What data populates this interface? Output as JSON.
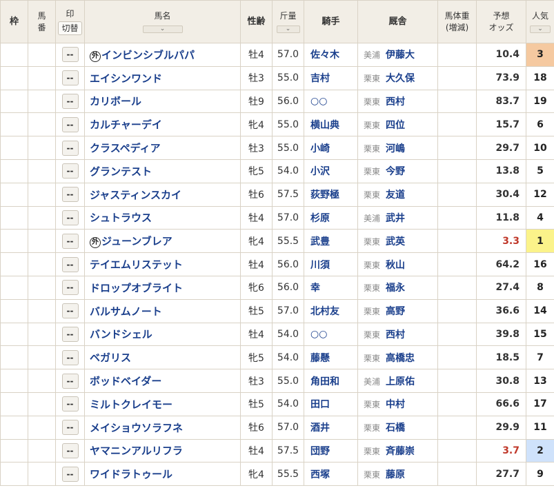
{
  "header": {
    "waku": "枠",
    "umaban_1": "馬",
    "umaban_2": "番",
    "mark": "印",
    "mark_toggle": "切替",
    "horse_name": "馬名",
    "sex_age": "性齢",
    "weight": "斤量",
    "jockey": "騎手",
    "stable": "厩舎",
    "body_weight_1": "馬体重",
    "body_weight_2": "(増減)",
    "odds_1": "予想",
    "odds_2": "オッズ",
    "popularity": "人気"
  },
  "mark_placeholder": "--",
  "foreign_badge": "外",
  "colors": {
    "header_bg": "#f2eee6",
    "link_blue": "#1a3f8c",
    "favorite_odds": "#c0392b",
    "pop1_bg": "#fbf38a",
    "pop2_bg": "#cfe2fb",
    "pop3_bg": "#f5c9a0"
  },
  "rows": [
    {
      "name": "インビンシブルパパ",
      "foreign": true,
      "sex_age": "牡4",
      "weight": "57.0",
      "jockey": "佐々木",
      "region": "美浦",
      "trainer": "伊藤大",
      "odds": "10.4",
      "popularity": "3"
    },
    {
      "name": "エイシンワンド",
      "foreign": false,
      "sex_age": "牡3",
      "weight": "55.0",
      "jockey": "吉村",
      "region": "栗東",
      "trainer": "大久保",
      "odds": "73.9",
      "popularity": "18"
    },
    {
      "name": "カリボール",
      "foreign": false,
      "sex_age": "牡9",
      "weight": "56.0",
      "jockey": "○○",
      "region": "栗東",
      "trainer": "西村",
      "odds": "83.7",
      "popularity": "19"
    },
    {
      "name": "カルチャーデイ",
      "foreign": false,
      "sex_age": "牝4",
      "weight": "55.0",
      "jockey": "横山典",
      "region": "栗東",
      "trainer": "四位",
      "odds": "15.7",
      "popularity": "6"
    },
    {
      "name": "クラスペディア",
      "foreign": false,
      "sex_age": "牡3",
      "weight": "55.0",
      "jockey": "小崎",
      "region": "栗東",
      "trainer": "河嶋",
      "odds": "29.7",
      "popularity": "10"
    },
    {
      "name": "グランテスト",
      "foreign": false,
      "sex_age": "牝5",
      "weight": "54.0",
      "jockey": "小沢",
      "region": "栗東",
      "trainer": "今野",
      "odds": "13.8",
      "popularity": "5"
    },
    {
      "name": "ジャスティンスカイ",
      "foreign": false,
      "sex_age": "牡6",
      "weight": "57.5",
      "jockey": "荻野極",
      "region": "栗東",
      "trainer": "友道",
      "odds": "30.4",
      "popularity": "12"
    },
    {
      "name": "シュトラウス",
      "foreign": false,
      "sex_age": "牡4",
      "weight": "57.0",
      "jockey": "杉原",
      "region": "美浦",
      "trainer": "武井",
      "odds": "11.8",
      "popularity": "4"
    },
    {
      "name": "ジューンブレア",
      "foreign": true,
      "sex_age": "牝4",
      "weight": "55.5",
      "jockey": "武豊",
      "region": "栗東",
      "trainer": "武英",
      "odds": "3.3",
      "popularity": "1"
    },
    {
      "name": "テイエムリステット",
      "foreign": false,
      "sex_age": "牡4",
      "weight": "56.0",
      "jockey": "川須",
      "region": "栗東",
      "trainer": "秋山",
      "odds": "64.2",
      "popularity": "16"
    },
    {
      "name": "ドロップオブライト",
      "foreign": false,
      "sex_age": "牝6",
      "weight": "56.0",
      "jockey": "幸",
      "region": "栗東",
      "trainer": "福永",
      "odds": "27.4",
      "popularity": "8"
    },
    {
      "name": "バルサムノート",
      "foreign": false,
      "sex_age": "牡5",
      "weight": "57.0",
      "jockey": "北村友",
      "region": "栗東",
      "trainer": "高野",
      "odds": "36.6",
      "popularity": "14"
    },
    {
      "name": "バンドシェル",
      "foreign": false,
      "sex_age": "牡4",
      "weight": "54.0",
      "jockey": "○○",
      "region": "栗東",
      "trainer": "西村",
      "odds": "39.8",
      "popularity": "15"
    },
    {
      "name": "ベガリス",
      "foreign": false,
      "sex_age": "牝5",
      "weight": "54.0",
      "jockey": "藤懸",
      "region": "栗東",
      "trainer": "高橋忠",
      "odds": "18.5",
      "popularity": "7"
    },
    {
      "name": "ボッドベイダー",
      "foreign": false,
      "sex_age": "牡3",
      "weight": "55.0",
      "jockey": "角田和",
      "region": "美浦",
      "trainer": "上原佑",
      "odds": "30.8",
      "popularity": "13"
    },
    {
      "name": "ミルトクレイモー",
      "foreign": false,
      "sex_age": "牡5",
      "weight": "54.0",
      "jockey": "田口",
      "region": "栗東",
      "trainer": "中村",
      "odds": "66.6",
      "popularity": "17"
    },
    {
      "name": "メイショウソラフネ",
      "foreign": false,
      "sex_age": "牡6",
      "weight": "57.0",
      "jockey": "酒井",
      "region": "栗東",
      "trainer": "石橋",
      "odds": "29.9",
      "popularity": "11"
    },
    {
      "name": "ヤマニンアルリフラ",
      "foreign": false,
      "sex_age": "牡4",
      "weight": "57.5",
      "jockey": "団野",
      "region": "栗東",
      "trainer": "斉藤崇",
      "odds": "3.7",
      "popularity": "2"
    },
    {
      "name": "ワイドラトゥール",
      "foreign": false,
      "sex_age": "牝4",
      "weight": "55.5",
      "jockey": "西塚",
      "region": "栗東",
      "trainer": "藤原",
      "odds": "27.7",
      "popularity": "9"
    }
  ]
}
